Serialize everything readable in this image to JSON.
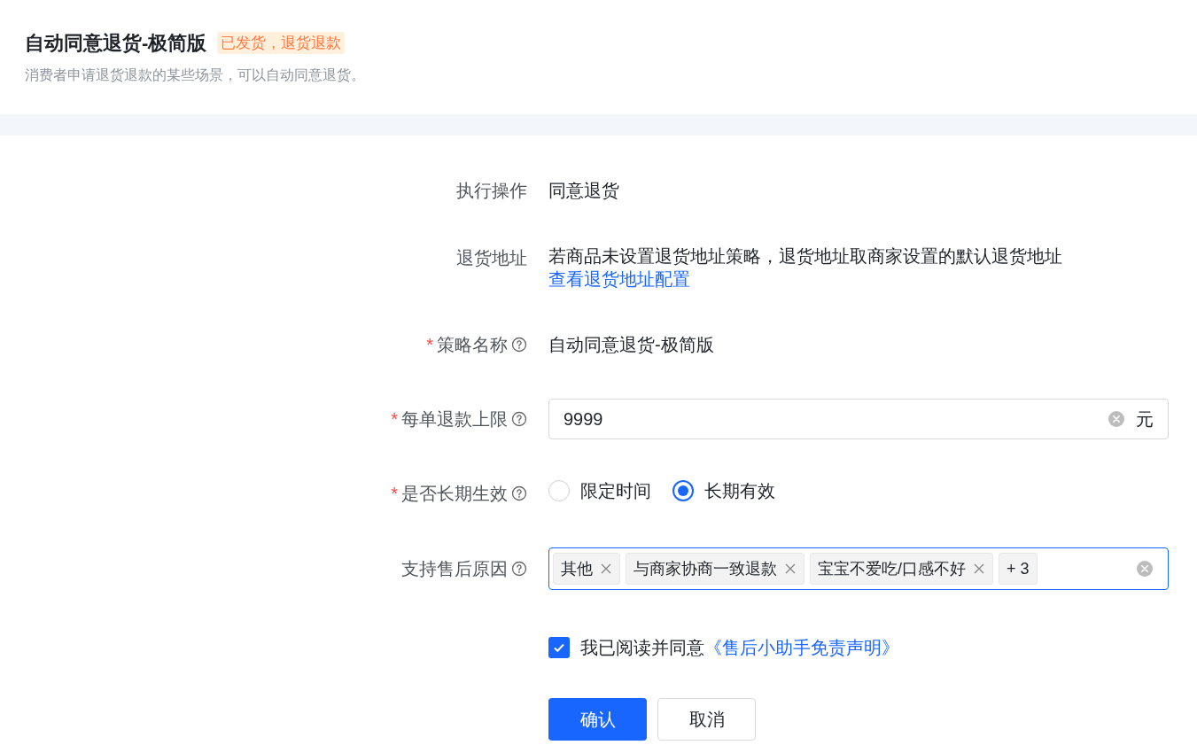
{
  "header": {
    "title": "自动同意退货-极简版",
    "tag": "已发货，退货退款",
    "description": "消费者申请退货退款的某些场景，可以自动同意退货。"
  },
  "form": {
    "rows": [
      {
        "kind": "text",
        "label": "执行操作",
        "help": false,
        "value": "同意退货"
      },
      {
        "kind": "text_link",
        "label": "退货地址",
        "help": false,
        "value": "若商品未设置退货地址策略，退货地址取商家设置的默认退货地址",
        "link": "查看退货地址配置"
      },
      {
        "kind": "text",
        "label": "策略名称",
        "required_mark": "*",
        "help": true,
        "value": "自动同意退货-极简版"
      },
      {
        "kind": "input",
        "label": "每单退款上限",
        "required_mark": "*",
        "help": true,
        "value": "9999",
        "suffix": "元"
      },
      {
        "kind": "radio",
        "label": "是否长期生效",
        "required_mark": "*",
        "help": true,
        "options": [
          {
            "label": "限定时间",
            "selected": false
          },
          {
            "label": "长期有效",
            "selected": true
          }
        ]
      },
      {
        "kind": "tags",
        "label": "支持售后原因",
        "help": true,
        "focused": true,
        "tags": [
          "其他",
          "与商家协商一致退款",
          "宝宝不爱吃/口感不好"
        ],
        "more": "+ 3"
      }
    ]
  },
  "agreement": {
    "checked": true,
    "text": "我已阅读并同意",
    "link": "《售后小助手免责声明》"
  },
  "buttons": [
    {
      "label": "确认",
      "kind": "primary"
    },
    {
      "label": "取消",
      "kind": "default"
    }
  ]
}
